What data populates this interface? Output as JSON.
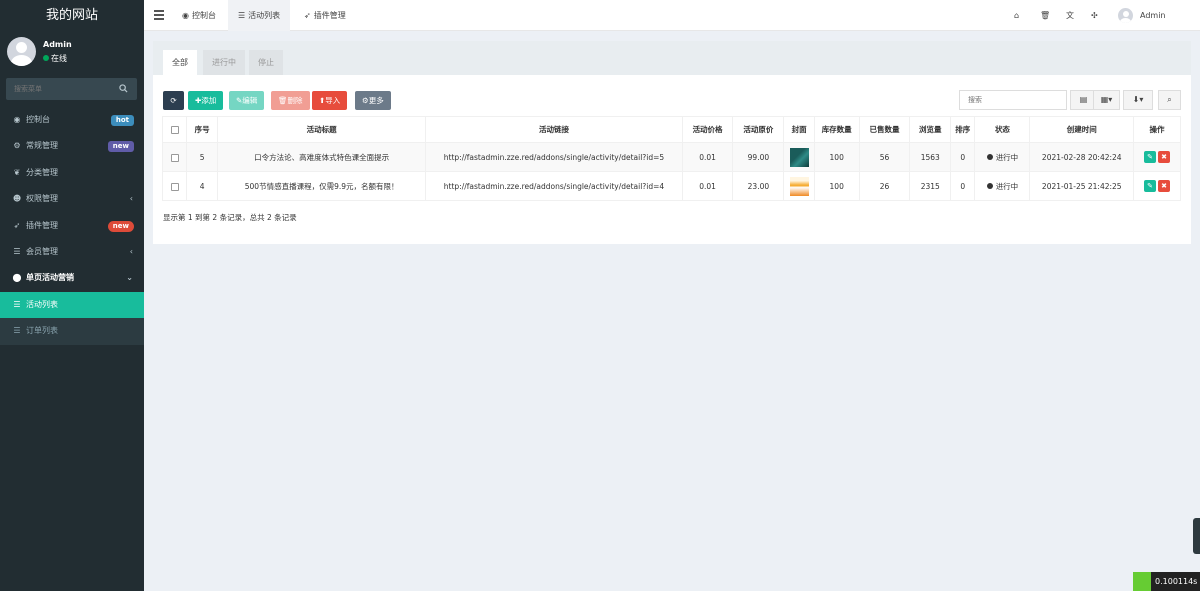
{
  "sidebar": {
    "logo": "我的网站",
    "user": {
      "name": "Admin",
      "status": "在线"
    },
    "search_placeholder": "搜索菜单",
    "menu": [
      {
        "label": "控制台",
        "icon": "dashboard-icon",
        "glyph": "◉",
        "badge": "hot",
        "badge_color": "#3c8dbc"
      },
      {
        "label": "常规管理",
        "icon": "cogs-icon",
        "glyph": "⚙",
        "badge": "new",
        "badge_color": "#605ca8"
      },
      {
        "label": "分类管理",
        "icon": "leaf-icon",
        "glyph": "❦"
      },
      {
        "label": "权限管理",
        "icon": "group-icon",
        "glyph": "☻",
        "arrow": "‹"
      },
      {
        "label": "插件管理",
        "icon": "rocket-icon",
        "glyph": "➶",
        "badge": "new",
        "badge_color": "#dd4b39"
      },
      {
        "label": "会员管理",
        "icon": "list-icon",
        "glyph": "☰",
        "arrow": "‹"
      },
      {
        "label": "单页活动营销",
        "icon": "map-marker-icon",
        "glyph": "⬤",
        "arrow": "⌄"
      },
      {
        "label": "活动列表",
        "icon": "list-icon",
        "glyph": "☰"
      },
      {
        "label": "订单列表",
        "icon": "list-icon",
        "glyph": "☰"
      }
    ]
  },
  "header": {
    "tabs": [
      {
        "label": "控制台",
        "icon": "dashboard-icon",
        "glyph": "◉"
      },
      {
        "label": "活动列表",
        "icon": "list-icon",
        "glyph": "☰"
      },
      {
        "label": "插件管理",
        "icon": "rocket-icon",
        "glyph": "➶"
      }
    ],
    "right_icons": [
      {
        "icon": "home-icon",
        "glyph": "⌂"
      },
      {
        "icon": "trash-icon",
        "glyph": "🗑"
      },
      {
        "icon": "language-icon",
        "glyph": "文"
      },
      {
        "icon": "fullscreen-icon",
        "glyph": "✣"
      }
    ],
    "user": "Admin"
  },
  "panel": {
    "tabs": [
      "全部",
      "进行中",
      "停止"
    ],
    "toolbar": {
      "refresh": "⟳",
      "add": "添加",
      "edit": "编辑",
      "delete": "删除",
      "import": "导入",
      "more": "更多",
      "search_placeholder": "搜索"
    },
    "columns": [
      "序号",
      "活动标题",
      "活动链接",
      "活动价格",
      "活动原价",
      "封面",
      "库存数量",
      "已售数量",
      "浏览量",
      "排序",
      "状态",
      "创建时间",
      "操作"
    ],
    "rows": [
      {
        "id": "5",
        "title": "口令方法论、高难度体式特色课全面提示",
        "link": "http://fastadmin.zze.red/addons/single/activity/detail?id=5",
        "price": "0.01",
        "orig_price": "99.00",
        "cover_color": "#1a5c5a",
        "stock": "100",
        "sold": "56",
        "views": "1563",
        "sort": "0",
        "status": "进行中",
        "created": "2021-02-28 20:42:24"
      },
      {
        "id": "4",
        "title": "500节情感直播课程，仅需9.9元，名额有限！",
        "link": "http://fastadmin.zze.red/addons/single/activity/detail?id=4",
        "price": "0.01",
        "orig_price": "23.00",
        "cover_color": "#f5a623",
        "stock": "100",
        "sold": "26",
        "views": "2315",
        "sort": "0",
        "status": "进行中",
        "created": "2021-01-25 21:42:25"
      }
    ],
    "pager": "显示第 1 到第 2 条记录，总共 2 条记录"
  },
  "timer": "0.100114s"
}
